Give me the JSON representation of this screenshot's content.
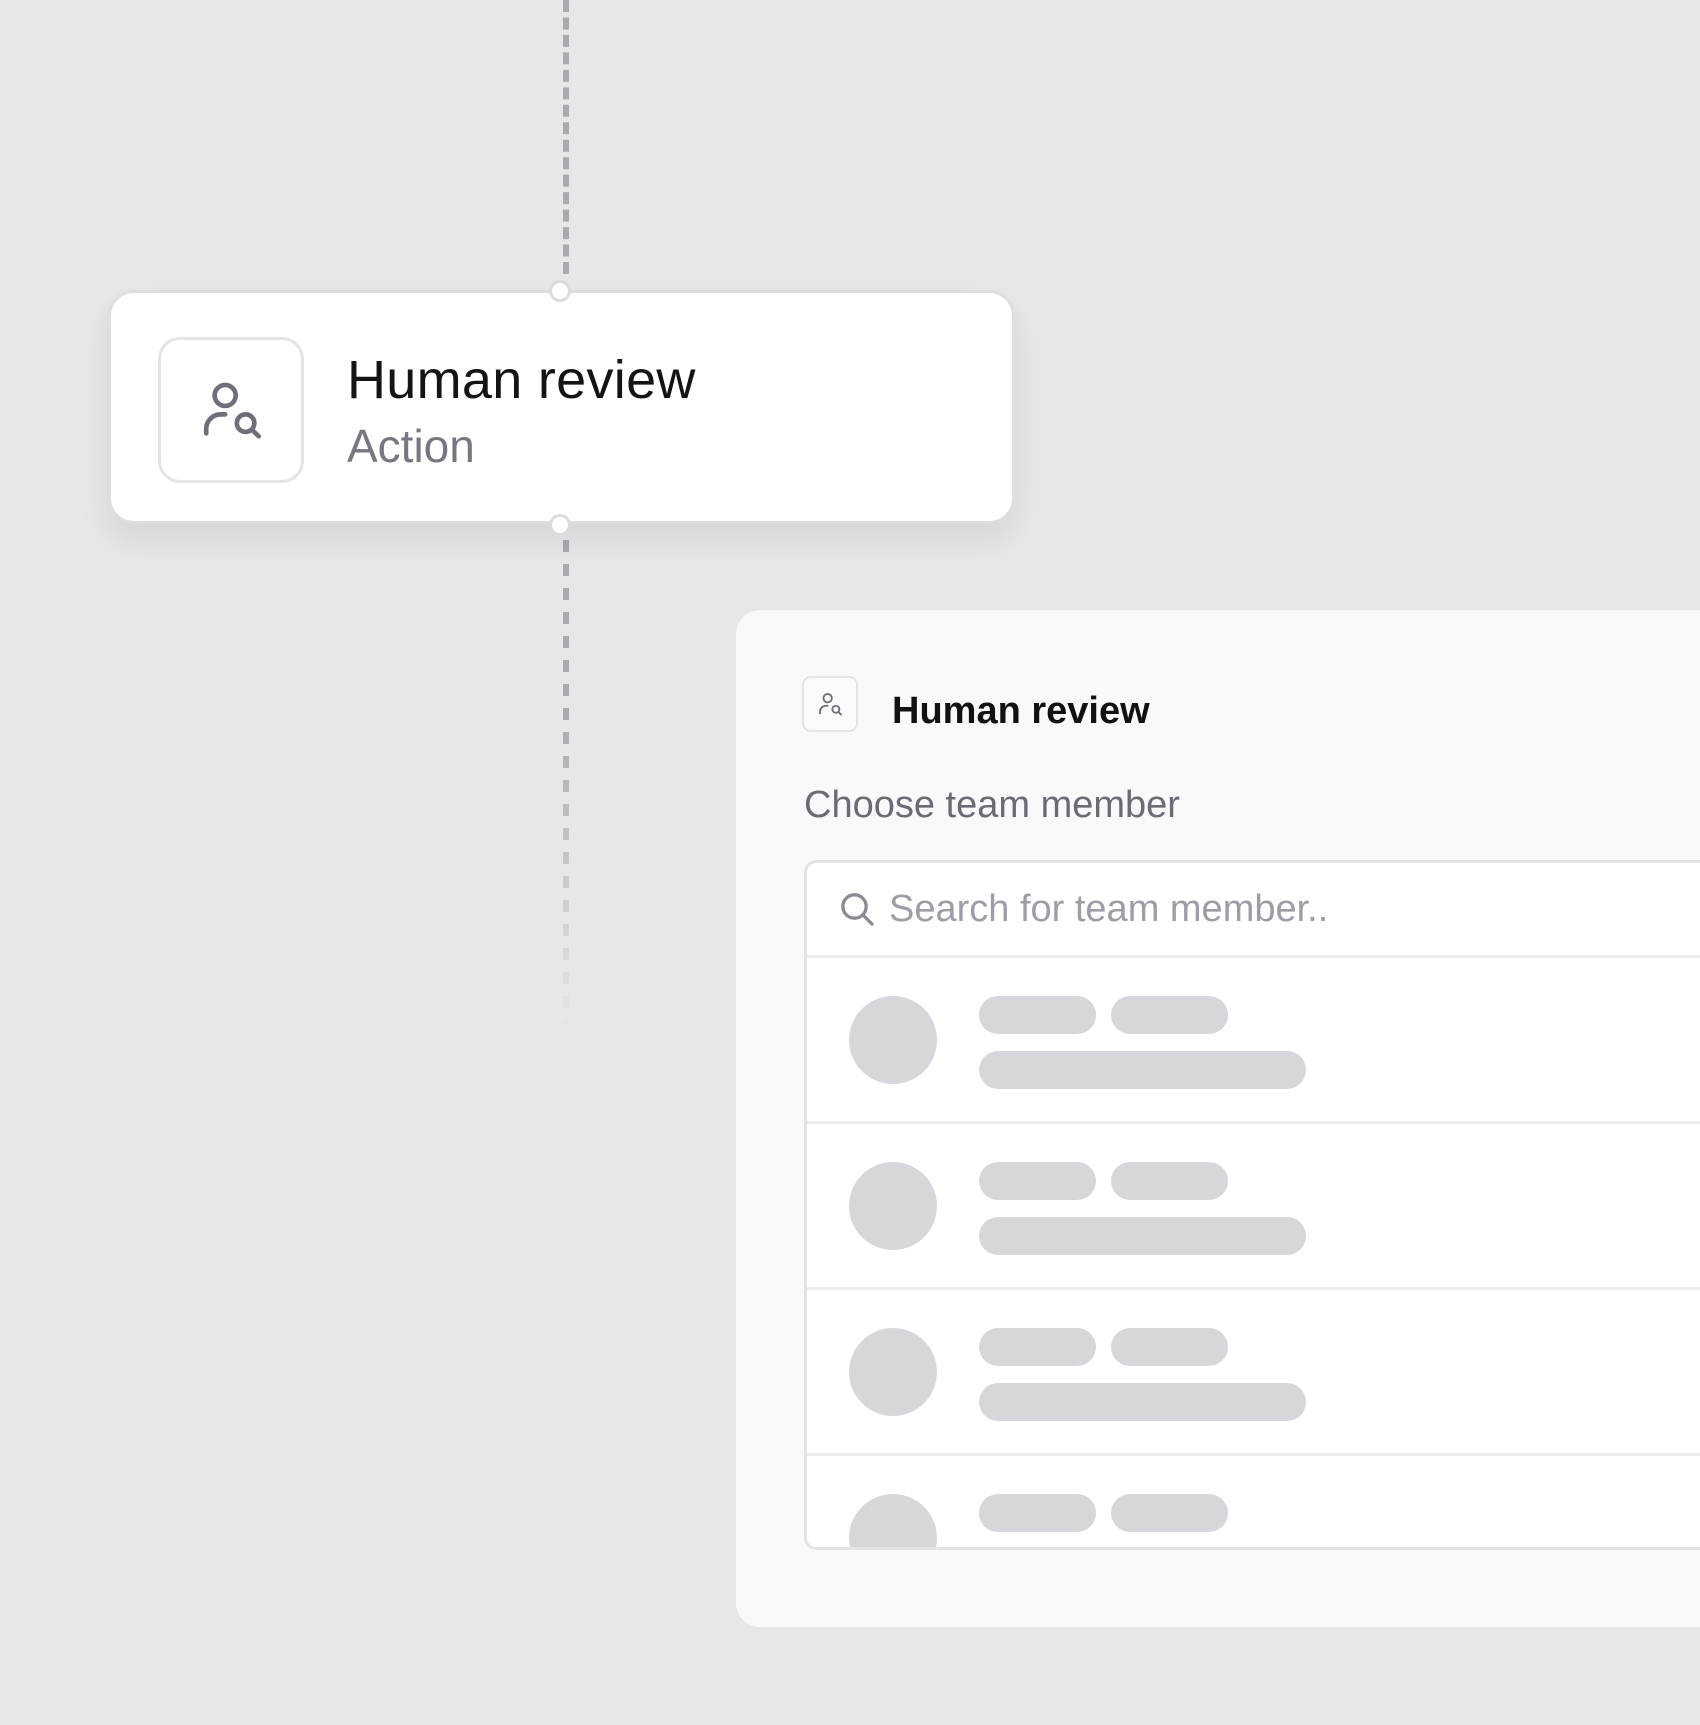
{
  "workflow_node": {
    "title": "Human review",
    "subtitle": "Action",
    "icon": "user-search-icon"
  },
  "panel": {
    "title": "Human review",
    "icon": "user-search-icon",
    "label": "Choose team member",
    "search": {
      "placeholder": "Search for team member..",
      "value": "",
      "icon": "search-icon"
    },
    "members": [
      {
        "state": "loading-skeleton"
      },
      {
        "state": "loading-skeleton"
      },
      {
        "state": "loading-skeleton"
      },
      {
        "state": "loading-skeleton"
      }
    ]
  },
  "colors": {
    "canvas": "#e7e7e9",
    "card": "#ffffff",
    "skeleton": "#d7d7db",
    "muted_text": "#777782"
  }
}
